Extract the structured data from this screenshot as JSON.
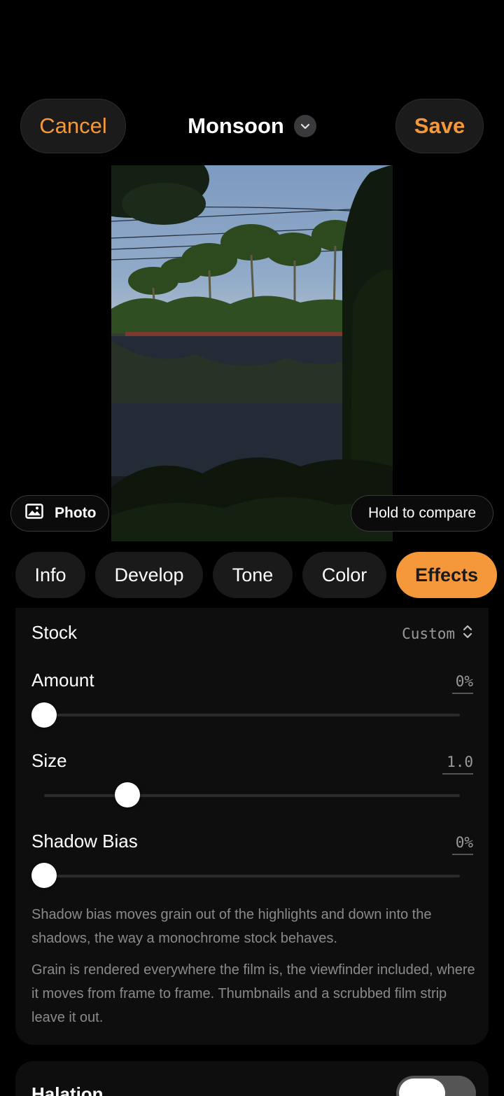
{
  "header": {
    "cancel_label": "Cancel",
    "title": "Monsoon",
    "save_label": "Save"
  },
  "photo_overlay": {
    "photo_chip_label": "Photo",
    "compare_label": "Hold to compare"
  },
  "tabs": [
    {
      "label": "Info",
      "active": false
    },
    {
      "label": "Develop",
      "active": false
    },
    {
      "label": "Tone",
      "active": false
    },
    {
      "label": "Color",
      "active": false
    },
    {
      "label": "Effects",
      "active": true
    }
  ],
  "grain": {
    "stock_label": "Stock",
    "stock_value": "Custom",
    "amount": {
      "label": "Amount",
      "value": "0%",
      "fraction": 0.0
    },
    "size": {
      "label": "Size",
      "value": "1.0",
      "fraction": 0.2
    },
    "shadow_bias": {
      "label": "Shadow Bias",
      "value": "0%",
      "fraction": 0.0
    },
    "note_1": "Shadow bias moves grain out of the highlights and down into the shadows, the way a monochrome stock behaves.",
    "note_2": "Grain is rendered everywhere the film is, the viewfinder included, where it moves from frame to frame. Thumbnails and a scrubbed film strip leave it out."
  },
  "halation": {
    "label": "Halation",
    "enabled": false
  },
  "colors": {
    "accent": "#f5983a",
    "background": "#000000",
    "panel": "#0e0e0e"
  },
  "icons": {
    "title_dropdown": "chevron-down-icon",
    "photo_chip": "image-icon",
    "stock_picker": "up-down-chevron-icon"
  }
}
